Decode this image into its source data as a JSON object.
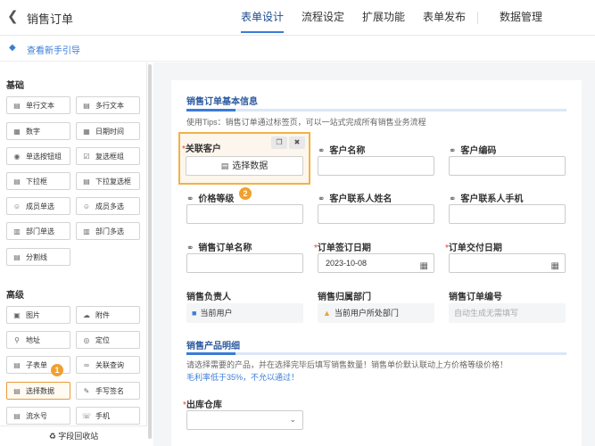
{
  "topbar": {
    "back_icon": "chevron-left-icon",
    "title": "销售订单",
    "tabs": [
      {
        "label": "表单设计",
        "active": true
      },
      {
        "label": "流程设定"
      },
      {
        "label": "扩展功能"
      },
      {
        "label": "表单发布"
      }
    ],
    "data_tab": "数据管理"
  },
  "guide": {
    "icon": "lightbulb-icon",
    "label": "查看新手引导"
  },
  "sidebar": {
    "basic_title": "基础",
    "basic_items": [
      {
        "label": "单行文本",
        "icon": "text-line-icon"
      },
      {
        "label": "多行文本",
        "icon": "text-multiline-icon"
      },
      {
        "label": "数字",
        "icon": "number-icon"
      },
      {
        "label": "日期时间",
        "icon": "calendar-icon"
      },
      {
        "label": "单选按钮组",
        "icon": "radio-icon"
      },
      {
        "label": "复选框组",
        "icon": "checkbox-icon"
      },
      {
        "label": "下拉框",
        "icon": "dropdown-icon"
      },
      {
        "label": "下拉复选框",
        "icon": "dropdown-check-icon"
      },
      {
        "label": "成员单选",
        "icon": "member-icon"
      },
      {
        "label": "成员多选",
        "icon": "members-icon"
      },
      {
        "label": "部门单选",
        "icon": "department-icon"
      },
      {
        "label": "部门多选",
        "icon": "departments-icon"
      },
      {
        "label": "分割线",
        "icon": "divider-icon"
      }
    ],
    "advanced_title": "高级",
    "advanced_items": [
      {
        "label": "图片",
        "icon": "image-icon"
      },
      {
        "label": "附件",
        "icon": "attachment-icon"
      },
      {
        "label": "地址",
        "icon": "location-icon"
      },
      {
        "label": "定位",
        "icon": "target-icon"
      },
      {
        "label": "子表单",
        "icon": "subform-icon"
      },
      {
        "label": "关联查询",
        "icon": "link-query-icon"
      },
      {
        "label": "选择数据",
        "icon": "select-data-icon",
        "selected": true
      },
      {
        "label": "手写签名",
        "icon": "signature-icon"
      },
      {
        "label": "流水号",
        "icon": "serial-icon"
      },
      {
        "label": "手机",
        "icon": "phone-icon"
      }
    ],
    "recycle_label": "字段回收站",
    "badge_1": "1"
  },
  "form": {
    "section1_title": "销售订单基本信息",
    "tips": "使用Tips：销售订单通过标签页，可以一站式完成所有销售业务流程",
    "fields": {
      "customer": {
        "label": "关联客户",
        "button": "选择数据",
        "badge": "2"
      },
      "customer_name": "客户名称",
      "customer_code": "客户编码",
      "price_level": "价格等级",
      "contact_name": "客户联系人姓名",
      "contact_phone": "客户联系人手机",
      "order_name": "销售订单名称",
      "sign_date": {
        "label": "订单签订日期",
        "value": "2023-10-08"
      },
      "delivery_date": "订单交付日期",
      "owner": {
        "label": "销售负责人",
        "value": "当前用户"
      },
      "dept": {
        "label": "销售归属部门",
        "value": "当前用户所处部门"
      },
      "order_no": {
        "label": "销售订单编号",
        "value": "自动生成无需填写"
      }
    },
    "section2_title": "销售产品明细",
    "section2_tip": "请选择需要的产品，并在选择完毕后填写销售数量！销售单价默认联动上方价格等级价格！",
    "section2_warn": "毛利率低于35%，不允以通过！",
    "warehouse": "出库仓库"
  }
}
